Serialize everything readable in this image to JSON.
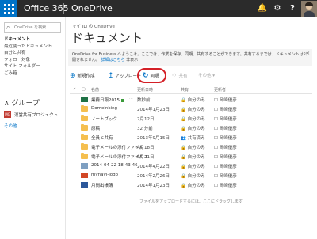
{
  "topbar": {
    "brand": "Office 365",
    "app": "OneDrive",
    "bell_icon": "bell-icon",
    "gear_icon": "gear-icon",
    "help_icon": "help-icon",
    "bell_glyph": "🔔",
    "gear_glyph": "⚙",
    "help_glyph": "?"
  },
  "sidebar": {
    "search_placeholder": "OneDrive を検索",
    "search_glyph": "⌕",
    "items": [
      {
        "label": "ドキュメント",
        "active": true
      },
      {
        "label": "最近使ったドキュメント"
      },
      {
        "label": "自分と共有"
      },
      {
        "label": "フォロー対象"
      },
      {
        "label": "サイト フォルダー"
      },
      {
        "label": "ごみ箱"
      }
    ],
    "groups_heading": "∧ グループ",
    "group": {
      "badge": "MG",
      "name": "運営共有プロジェクト"
    },
    "more": "その他"
  },
  "main": {
    "breadcrumb": "マイ ILI の OneDrive",
    "title": "ドキュメント",
    "banner_text": "OneDrive for Business へようこそ。ここでは、作業を保存、同期、共有することができます。共有するまでは、ドキュメントは公開されません。",
    "banner_link": "詳細はこちら",
    "banner_tail": "非表示",
    "banner_close": "×",
    "commands": {
      "new": {
        "glyph": "⊕",
        "label": "新規作成"
      },
      "upload": {
        "glyph": "↥",
        "label": "アップロード"
      },
      "sync": {
        "glyph": "↻",
        "label": "同期"
      },
      "share": {
        "glyph": "⁘",
        "label": "共有"
      },
      "more": {
        "label": "その他 ▾"
      }
    },
    "columns": {
      "check": "✓",
      "name": "名前",
      "modified": "更新日時",
      "sharing": "共有",
      "editor": "更新者"
    },
    "rows": [
      {
        "type": "xlsx",
        "name": "業務日報2015",
        "is_new": true,
        "modified": "数秒前",
        "sharing": "自分のみ",
        "editor": "岡崎優彦"
      },
      {
        "type": "folder",
        "name": "Domeinking",
        "modified": "2014年1月23日",
        "sharing": "自分のみ",
        "editor": "岡崎優彦"
      },
      {
        "type": "folder",
        "name": "ノートブック",
        "modified": "7月12日",
        "sharing": "自分のみ",
        "editor": "岡崎優彦"
      },
      {
        "type": "folder",
        "name": "原稿",
        "modified": "32 分前",
        "sharing": "自分のみ",
        "editor": "岡崎優彦"
      },
      {
        "type": "folder",
        "name": "全員と共有",
        "modified": "2013年9月15日",
        "sharing": "共有済み",
        "editor": "岡崎優彦"
      },
      {
        "type": "folder",
        "name": "電子メールの添付ファイル",
        "modified": "4月18日",
        "sharing": "自分のみ",
        "editor": "岡崎優彦"
      },
      {
        "type": "folder",
        "name": "電子メールの添付ファイル 1",
        "modified": "6月21日",
        "sharing": "自分のみ",
        "editor": "岡崎優彦"
      },
      {
        "type": "img",
        "name": "2014-04-22 18-43-46",
        "modified": "2014年4月22日",
        "sharing": "自分のみ",
        "editor": "岡崎優彦"
      },
      {
        "type": "pptx",
        "name": "mynavi-logo",
        "modified": "2014年2月26日",
        "sharing": "自分のみ",
        "editor": "岡崎優彦"
      },
      {
        "type": "docx",
        "name": "月間出帳簿",
        "modified": "2014年1月23日",
        "sharing": "自分のみ",
        "editor": "岡崎優彦"
      }
    ],
    "footer": "ファイルをアップロードするには、ここにドラッグします",
    "lock_glyph": "🔒",
    "people_glyph": "👥",
    "dots": "···"
  }
}
